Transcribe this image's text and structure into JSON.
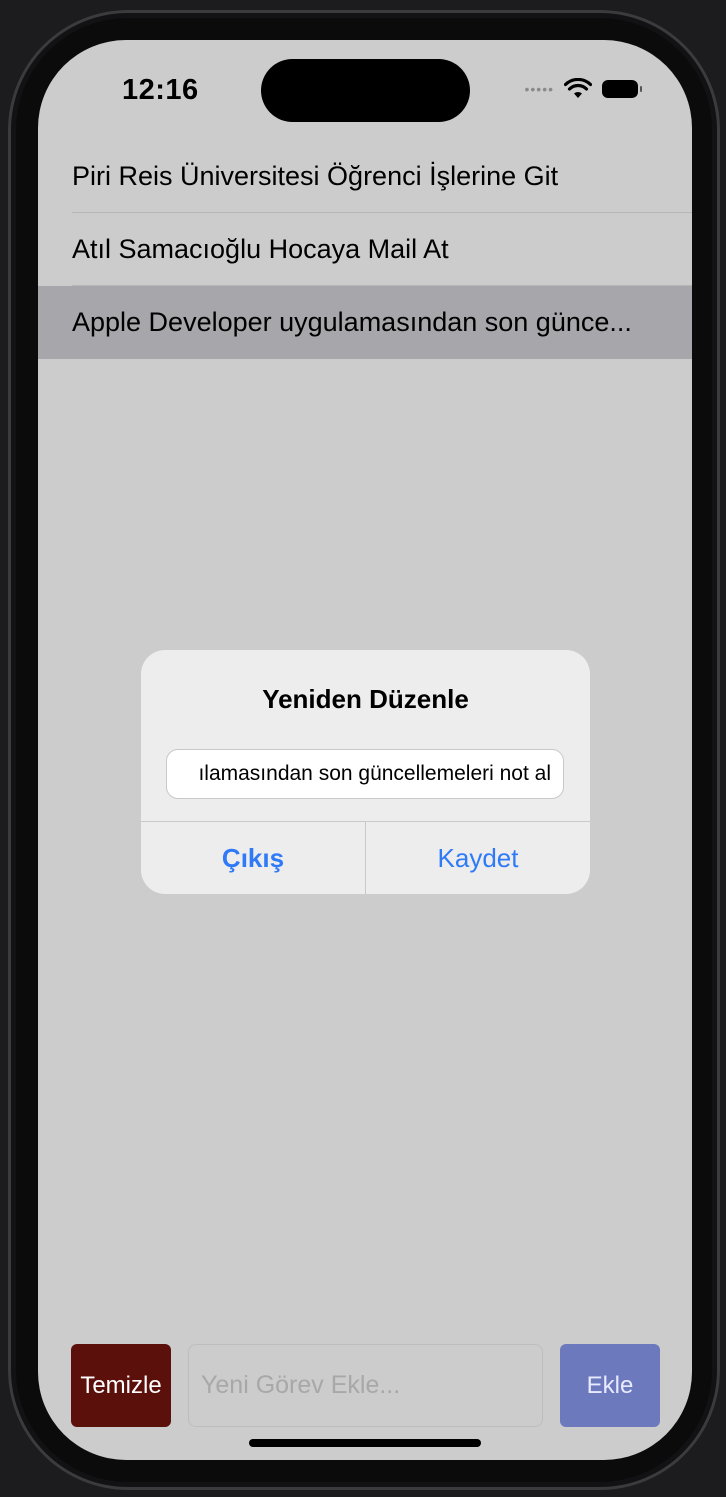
{
  "status_bar": {
    "time": "12:16",
    "signal_icon": "signal-dots-icon",
    "wifi_icon": "wifi-icon",
    "battery_icon": "battery-icon"
  },
  "tasks": [
    {
      "label": "Piri Reis Üniversitesi Öğrenci İşlerine Git",
      "selected": false
    },
    {
      "label": "Atıl Samacıoğlu Hocaya Mail At",
      "selected": false
    },
    {
      "label": "Apple Developer uygulamasından son günce...",
      "selected": true
    }
  ],
  "alert": {
    "title": "Yeniden Düzenle",
    "input_value": "ılamasından son güncellemeleri not al",
    "cancel_label": "Çıkış",
    "save_label": "Kaydet",
    "button_color": "#2f7af6"
  },
  "bottom_bar": {
    "clear_label": "Temizle",
    "input_placeholder": "Yeni Görev Ekle...",
    "add_label": "Ekle",
    "clear_color": "#5b100b",
    "add_color": "#6c79bd"
  }
}
